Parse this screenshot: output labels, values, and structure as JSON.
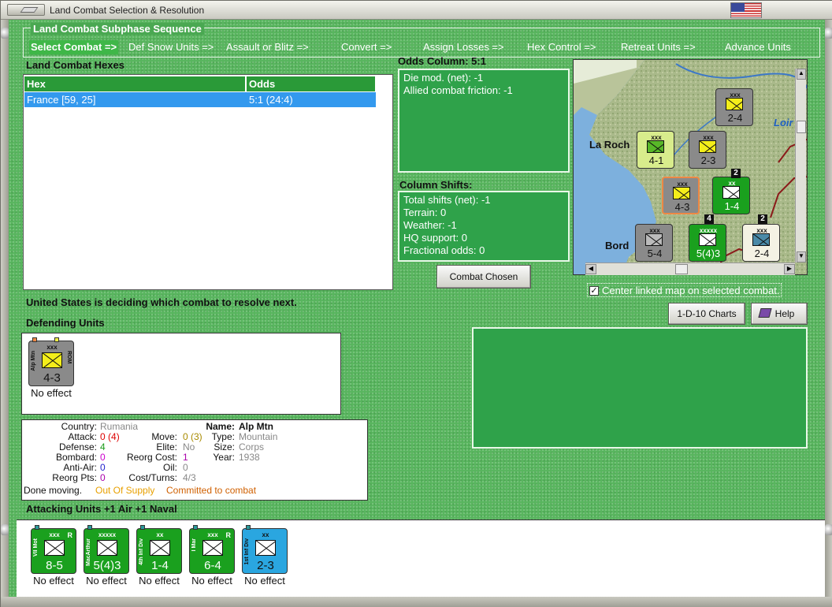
{
  "window": {
    "title": "Land Combat Selection & Resolution"
  },
  "subphase": {
    "title": "Land Combat Subphase Sequence",
    "steps": [
      "Select Combat =>",
      "Def Snow Units =>",
      "Assault or Blitz =>",
      "Convert =>",
      "Assign Losses =>",
      "Hex Control =>",
      "Retreat Units =>",
      "Advance Units"
    ]
  },
  "hexes": {
    "label": "Land Combat Hexes",
    "col_hex": "Hex",
    "col_odds": "Odds",
    "rows": [
      {
        "hex": "France [59, 25]",
        "odds": "5:1 (24:4)"
      }
    ]
  },
  "odds": {
    "label": "Odds Column: 5:1",
    "lines": [
      "Die mod. (net): -1",
      "Allied combat friction: -1"
    ]
  },
  "shifts": {
    "label": "Column Shifts:",
    "lines": [
      "Total shifts (net): -1",
      "Terrain: 0",
      "Weather: -1",
      "HQ support: 0",
      "Fractional odds: 0"
    ]
  },
  "buttons": {
    "combat_chosen": "Combat Chosen",
    "charts": "1-D-10 Charts",
    "help": "Help"
  },
  "map": {
    "labels": [
      "La Roch",
      "Bord",
      "Loir"
    ],
    "counters": [
      {
        "size": "xxx",
        "side": "Cav",
        "nat": "ROM",
        "str": "2-4"
      },
      {
        "size": "xxx",
        "side": "XX Corps",
        "nat": "",
        "str": "4-1"
      },
      {
        "size": "xxx",
        "side": "Comandi",
        "nat": "ROM",
        "str": "2-3"
      },
      {
        "size": "xxx",
        "side": "Alp Mtn",
        "nat": "ROM",
        "str": "4-3"
      },
      {
        "size": "xx",
        "side": "4th Inf Div",
        "nat": "",
        "str": "1-4"
      },
      {
        "size": "xxx",
        "side": "II Inf",
        "nat": "",
        "str": "5-4"
      },
      {
        "size": "xxxxx",
        "side": "MacArthur",
        "nat": "",
        "str": "5(4)3"
      },
      {
        "size": "xxx",
        "side": "Cav",
        "nat": "YUG",
        "str": "2-4"
      },
      {
        "size": "xxx",
        "side": "",
        "nat": "",
        "str": ""
      },
      {
        "size": "xxx",
        "side": "",
        "nat": "",
        "str": ""
      }
    ],
    "stack_badges": [
      "2",
      "4",
      "2"
    ]
  },
  "center_linked": {
    "label": "Center linked map on selected combat.",
    "checked": "✓"
  },
  "status": "United States is deciding which combat to resolve next.",
  "defending": {
    "label": "Defending Units",
    "units": [
      {
        "size": "xxx",
        "side": "Alp Mtn",
        "nat": "ROM",
        "str": "4-3",
        "effect": "No effect"
      }
    ]
  },
  "info": {
    "country_l": "Country:",
    "country_v": "Rumania",
    "attack_l": "Attack:",
    "attack_v": "0",
    "attack_v2": "(4)",
    "defense_l": "Defense:",
    "defense_v": "4",
    "bombard_l": "Bombard:",
    "bombard_v": "0",
    "antiair_l": "Anti-Air:",
    "antiair_v": "0",
    "reorgpts_l": "Reorg Pts:",
    "reorgpts_v": "0",
    "move_l": "Move:",
    "move_v": "0 (3)",
    "elite_l": "Elite:",
    "elite_v": "No",
    "reorgcost_l": "Reorg Cost:",
    "reorgcost_v": "1",
    "oil_l": "Oil:",
    "oil_v": "0",
    "costturns_l": "Cost/Turns:",
    "costturns_v": "4/3",
    "name_l": "Name:",
    "name_v": "Alp Mtn",
    "type_l": "Type:",
    "type_v": "Mountain",
    "sz_l": "Size:",
    "sz_v": "Corps",
    "year_l": "Year:",
    "year_v": "1938",
    "done": "Done moving.",
    "supply": "Out Of Supply",
    "committed": "Committed to combat"
  },
  "attacking": {
    "label": "Attacking Units +1 Air +1 Naval",
    "units": [
      {
        "size": "xxx",
        "side": "VII Mot",
        "nat": "",
        "r": "R",
        "str": "8-5",
        "effect": "No effect"
      },
      {
        "size": "xxxxx",
        "side": "MacArthur",
        "nat": "",
        "r": "",
        "str": "5(4)3",
        "effect": "No effect"
      },
      {
        "size": "xx",
        "side": "4th Inf Div",
        "nat": "",
        "r": "",
        "str": "1-4",
        "effect": "No effect"
      },
      {
        "size": "xxx",
        "side": "I Mar",
        "nat": "",
        "r": "R",
        "str": "6-4",
        "effect": "No effect"
      },
      {
        "size": "xx",
        "side": "1st Inf Div",
        "nat": "",
        "r": "",
        "str": "2-3",
        "effect": "No effect"
      }
    ]
  },
  "colors": {
    "accent_green": "#2fa24a",
    "selection_blue": "#3399ee",
    "us_counter": "#1aa01e",
    "us_marine": "#2aa6e0",
    "rom_counter": "#8a8a8a",
    "rom_symbol": "#f4ee1a"
  }
}
